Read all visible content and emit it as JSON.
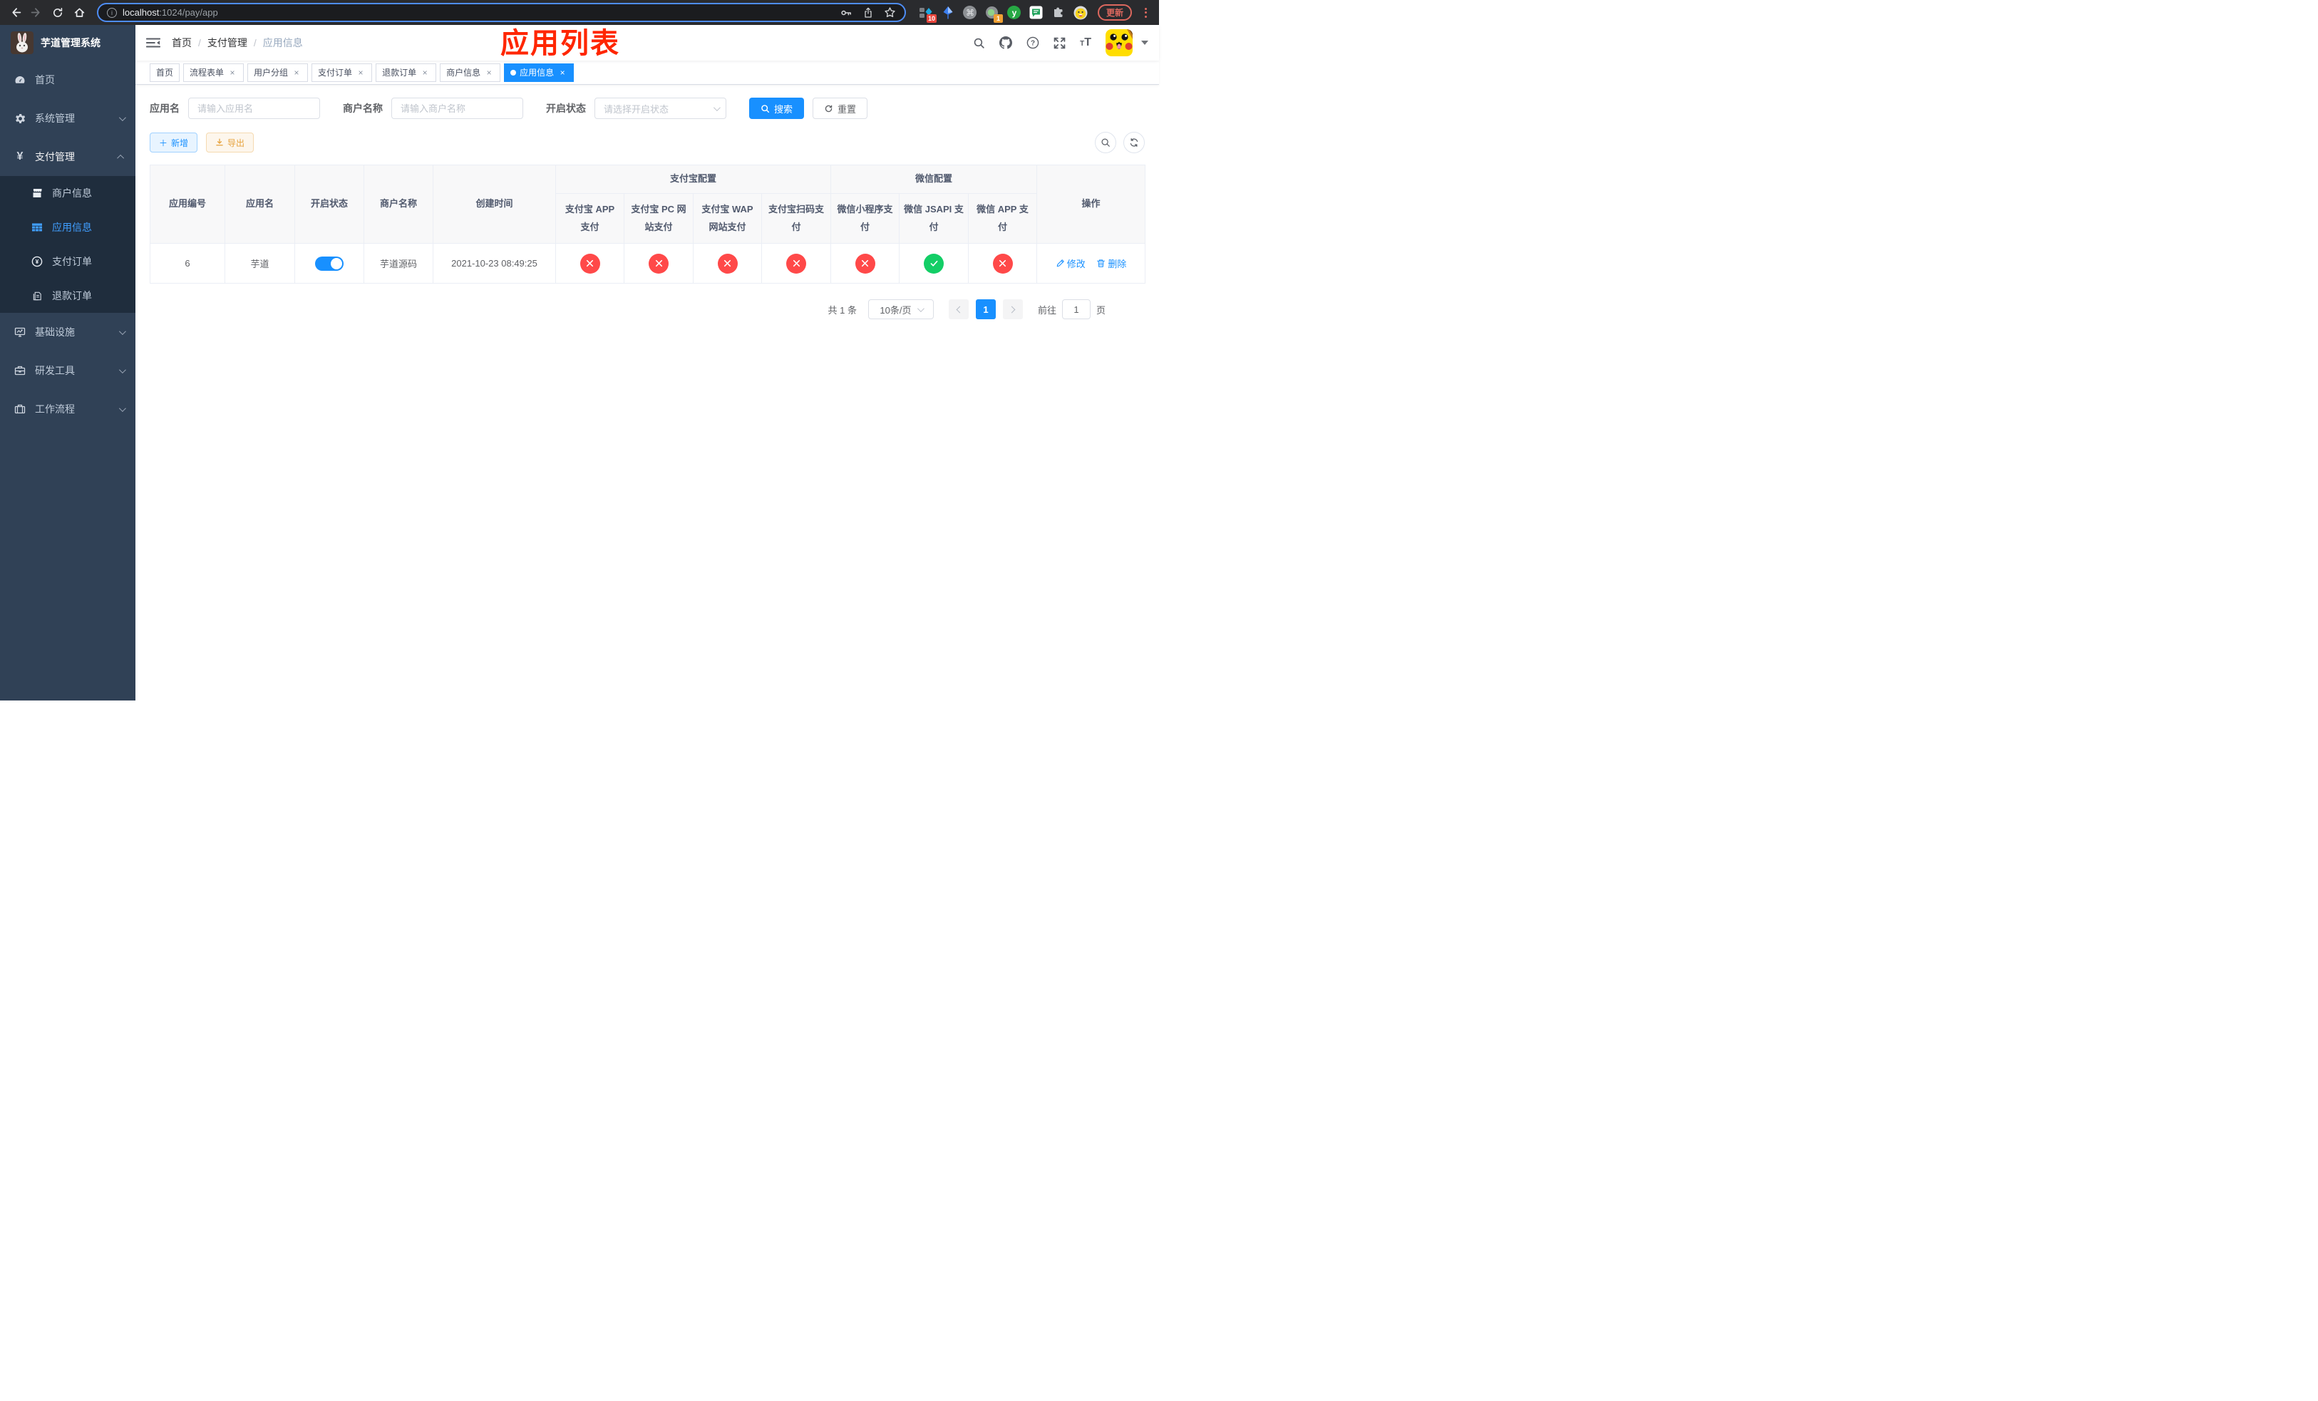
{
  "browser": {
    "url_host": "localhost",
    "url_path": ":1024/pay/app",
    "badge_tampermonkey": "10",
    "badge_proxy": "1",
    "ext_letter": "y",
    "update_label": "更新"
  },
  "overlay_title": "应用列表",
  "sidebar": {
    "title": "芋道管理系统",
    "items": [
      {
        "label": "首页"
      },
      {
        "label": "系统管理"
      },
      {
        "label": "支付管理"
      },
      {
        "label": "基础设施"
      },
      {
        "label": "研发工具"
      },
      {
        "label": "工作流程"
      }
    ],
    "sub_items": [
      {
        "label": "商户信息"
      },
      {
        "label": "应用信息"
      },
      {
        "label": "支付订单"
      },
      {
        "label": "退款订单"
      }
    ]
  },
  "navbar": {
    "breadcrumb": [
      {
        "label": "首页"
      },
      {
        "label": "支付管理"
      },
      {
        "label": "应用信息"
      }
    ]
  },
  "tabs": [
    {
      "label": "首页",
      "closable": false,
      "active": false
    },
    {
      "label": "流程表单",
      "closable": true,
      "active": false
    },
    {
      "label": "用户分组",
      "closable": true,
      "active": false
    },
    {
      "label": "支付订单",
      "closable": true,
      "active": false
    },
    {
      "label": "退款订单",
      "closable": true,
      "active": false
    },
    {
      "label": "商户信息",
      "closable": true,
      "active": false
    },
    {
      "label": "应用信息",
      "closable": true,
      "active": true
    }
  ],
  "filters": {
    "app_name_label": "应用名",
    "app_name_placeholder": "请输入应用名",
    "merchant_label": "商户名称",
    "merchant_placeholder": "请输入商户名称",
    "status_label": "开启状态",
    "status_placeholder": "请选择开启状态",
    "search_label": "搜索",
    "reset_label": "重置"
  },
  "toolbar": {
    "add_label": "新增",
    "export_label": "导出"
  },
  "table": {
    "columns": [
      "应用编号",
      "应用名",
      "开启状态",
      "商户名称",
      "创建时间"
    ],
    "group_alipay": "支付宝配置",
    "group_wechat": "微信配置",
    "pay_columns": [
      "支付宝 APP 支付",
      "支付宝 PC 网站支付",
      "支付宝 WAP 网站支付",
      "支付宝扫码支付",
      "微信小程序支付",
      "微信 JSAPI 支付",
      "微信 APP 支付"
    ],
    "actions_column": "操作",
    "row": {
      "id": "6",
      "name": "芋道",
      "enabled": true,
      "merchant": "芋道源码",
      "created": "2021-10-23 08:49:25",
      "pay_status": [
        false,
        false,
        false,
        false,
        false,
        true,
        false
      ],
      "edit_label": "修改",
      "delete_label": "删除"
    }
  },
  "pagination": {
    "total": "共 1 条",
    "page_size": "10条/页",
    "page": "1",
    "goto_label": "前往",
    "goto_value": "1",
    "unit_label": "页"
  },
  "colors": {
    "primary": "#1890ff",
    "sidebar_active": "#409eff",
    "success": "#13ce66",
    "danger": "#ff4949",
    "warning": "#e6a23c",
    "annotation": "#ff2600"
  }
}
